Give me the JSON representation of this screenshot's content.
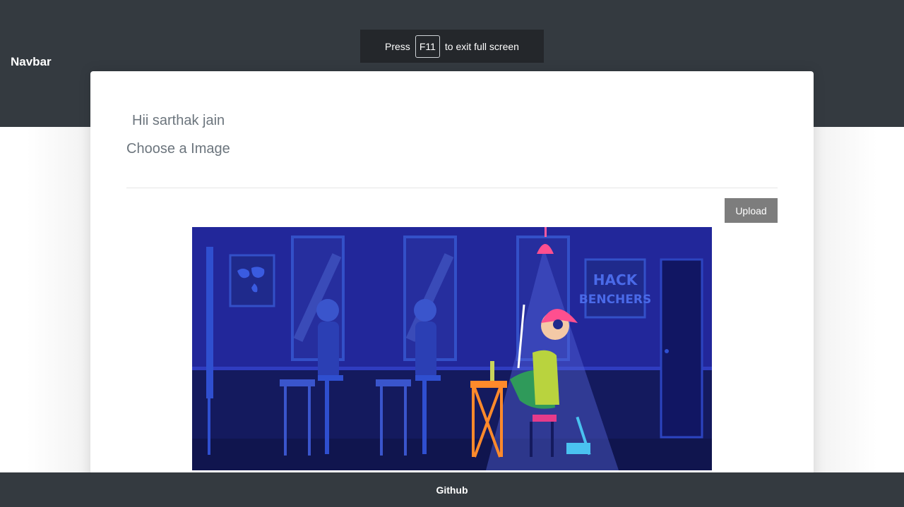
{
  "navbar": {
    "brand": "Navbar"
  },
  "fullscreen_notice": {
    "press": "Press",
    "key": "F11",
    "suffix": "to exit full screen"
  },
  "card": {
    "greeting": "Hii sarthak jain",
    "file_label": "Choose a Image",
    "upload_label": "Upload"
  },
  "preview_image": {
    "sign_line1": "HACK",
    "sign_line2": "BENCHERS",
    "colors": {
      "wall": "#22279a",
      "floor": "#141a5e",
      "accent": "#2f4fd0"
    }
  },
  "footer": {
    "link": "Github"
  }
}
